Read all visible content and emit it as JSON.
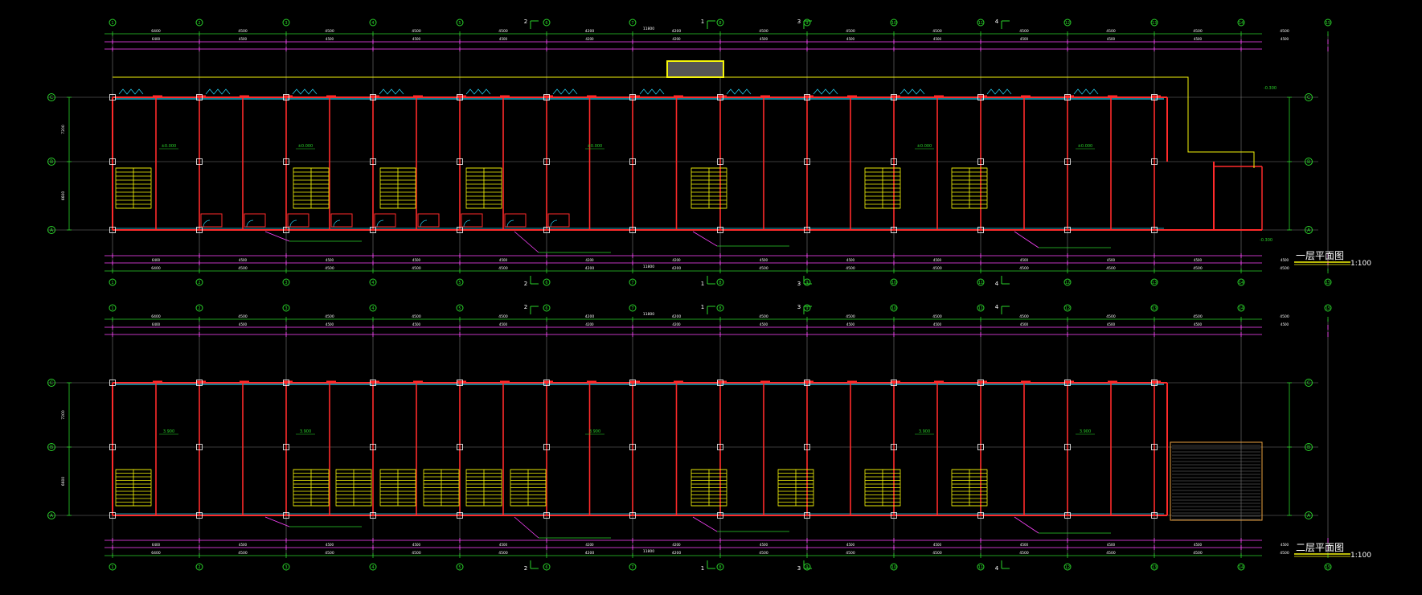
{
  "colors": {
    "background": "#000000",
    "grid": "#7a7a7a",
    "wall": "#ff2a2a",
    "dim": "#ff44ff",
    "axis": "#2ad22a",
    "window": "#22c8e8",
    "stair": "#f5f50a",
    "roof": "#e8a040",
    "text_white": "#ffffff"
  },
  "axes": {
    "numbers": [
      "1",
      "2",
      "3",
      "4",
      "5",
      "6",
      "7",
      "8",
      "9",
      "10",
      "11",
      "12",
      "13",
      "14",
      "15"
    ],
    "letters": [
      "C",
      "B",
      "A"
    ]
  },
  "section_marks": [
    "2",
    "1",
    "3",
    "4"
  ],
  "dimension_labels": {
    "bay": "4500",
    "first_end": "6400",
    "short": "4200",
    "depth_top": "7200",
    "depth_bottom": "6600",
    "total": "11800"
  },
  "level_labels": {
    "floor1": "±0.000",
    "floor1_out": "-0.300",
    "floor2": "3.900"
  },
  "plans": [
    {
      "title": "一层平面图",
      "scale": "1:100"
    },
    {
      "title": "二层平面图",
      "scale": "1:100"
    }
  ]
}
